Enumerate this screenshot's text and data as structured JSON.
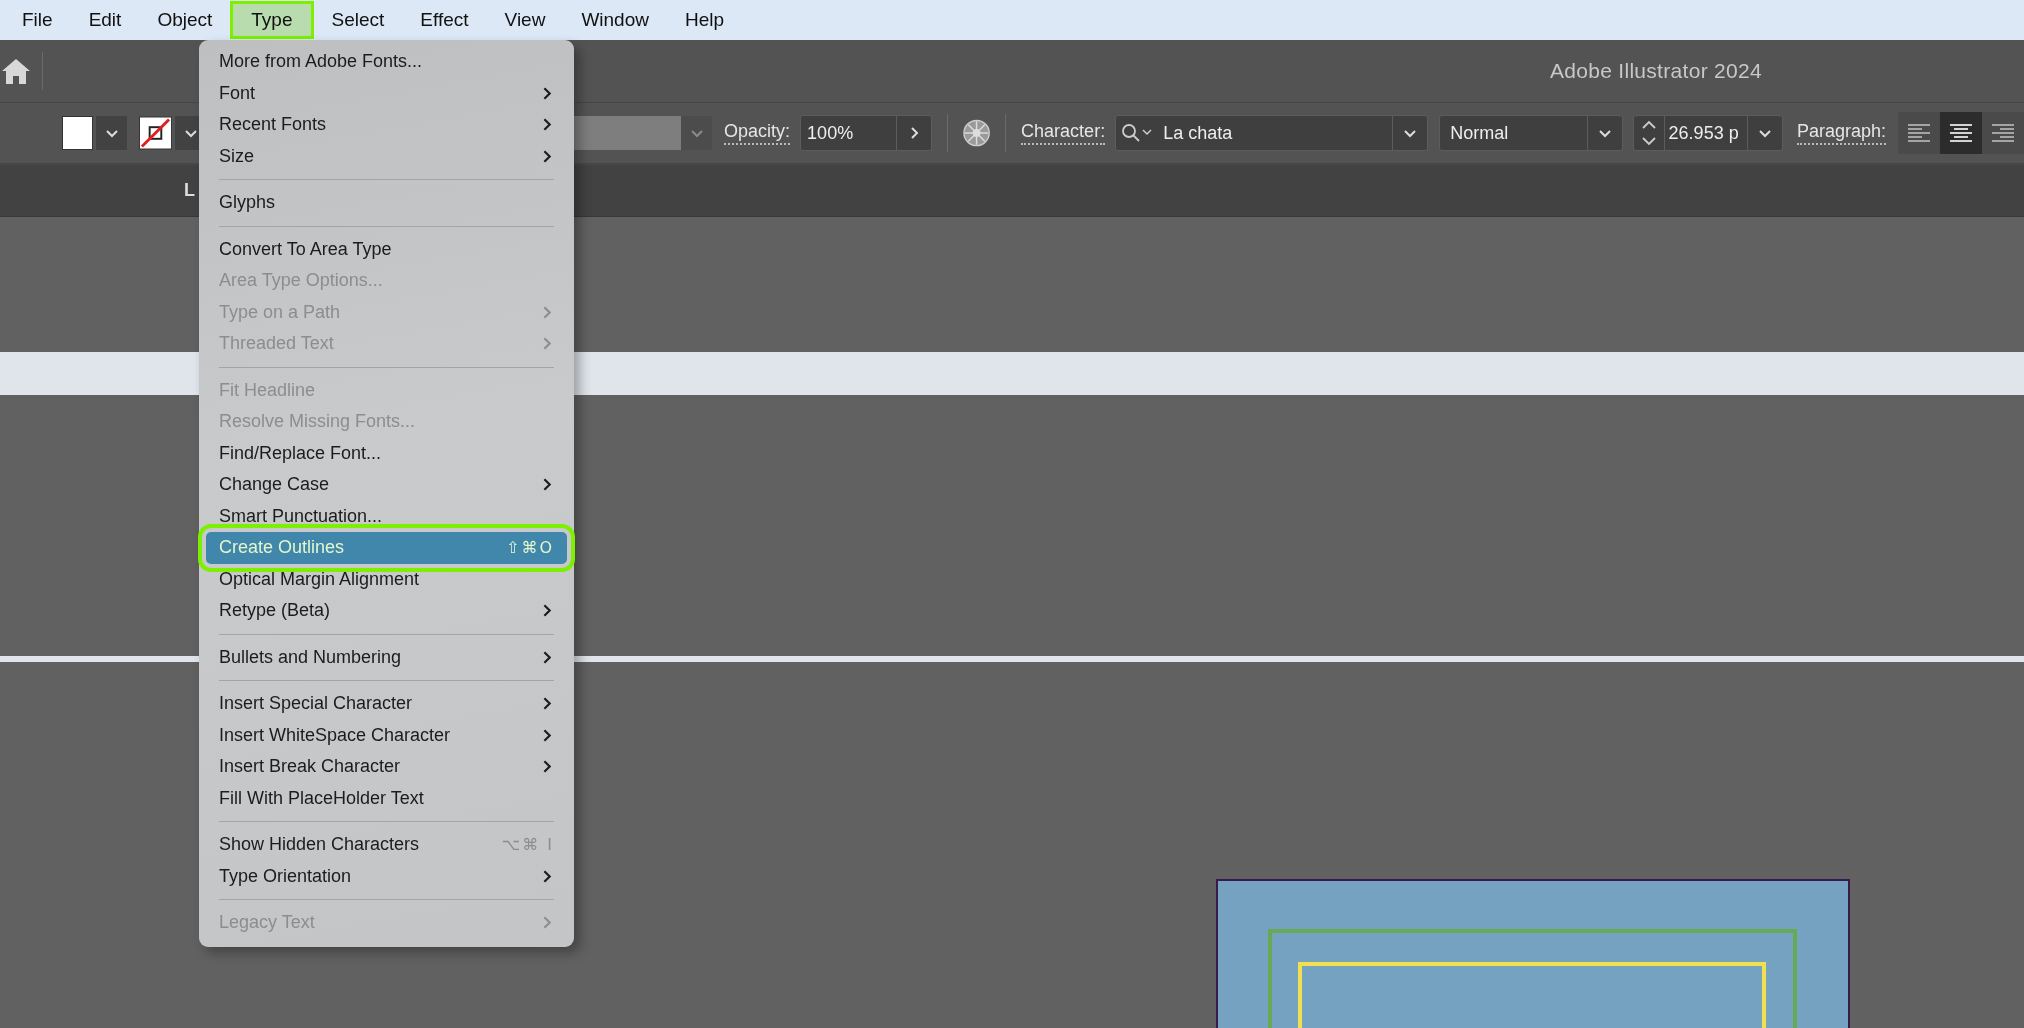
{
  "menubar": {
    "items": [
      {
        "label": "File",
        "selected": false
      },
      {
        "label": "Edit",
        "selected": false
      },
      {
        "label": "Object",
        "selected": false
      },
      {
        "label": "Type",
        "selected": true
      },
      {
        "label": "Select",
        "selected": false
      },
      {
        "label": "Effect",
        "selected": false
      },
      {
        "label": "View",
        "selected": false
      },
      {
        "label": "Window",
        "selected": false
      },
      {
        "label": "Help",
        "selected": false
      }
    ]
  },
  "app_bar": {
    "title": "Adobe Illustrator 2024"
  },
  "control_bar": {
    "opacity_label": "Opacity:",
    "opacity_value": "100%",
    "character_label": "Character:",
    "font_family": "La chata",
    "font_style": "Normal",
    "font_size": "26.953 p",
    "paragraph_label": "Paragraph:",
    "align_buttons": [
      {
        "kind": "left",
        "selected": false
      },
      {
        "kind": "center",
        "selected": true
      },
      {
        "kind": "right",
        "selected": false
      }
    ]
  },
  "tabs": [
    {
      "label": "L"
    }
  ],
  "type_menu": {
    "groups": [
      {
        "items": [
          {
            "label": "More from Adobe Fonts...",
            "disabled": false,
            "submenu": false,
            "selected": false
          },
          {
            "label": "Font",
            "disabled": false,
            "submenu": true,
            "selected": false
          },
          {
            "label": "Recent Fonts",
            "disabled": false,
            "submenu": true,
            "selected": false
          },
          {
            "label": "Size",
            "disabled": false,
            "submenu": true,
            "selected": false
          }
        ]
      },
      {
        "items": [
          {
            "label": "Glyphs",
            "disabled": false,
            "submenu": false,
            "selected": false
          }
        ]
      },
      {
        "items": [
          {
            "label": "Convert To Area Type",
            "disabled": false,
            "submenu": false,
            "selected": false
          },
          {
            "label": "Area Type Options...",
            "disabled": true,
            "submenu": false,
            "selected": false
          },
          {
            "label": "Type on a Path",
            "disabled": true,
            "submenu": true,
            "selected": false
          },
          {
            "label": "Threaded Text",
            "disabled": true,
            "submenu": true,
            "selected": false
          }
        ]
      },
      {
        "items": [
          {
            "label": "Fit Headline",
            "disabled": true,
            "submenu": false,
            "selected": false
          },
          {
            "label": "Resolve Missing Fonts...",
            "disabled": true,
            "submenu": false,
            "selected": false
          },
          {
            "label": "Find/Replace Font...",
            "disabled": false,
            "submenu": false,
            "selected": false
          },
          {
            "label": "Change Case",
            "disabled": false,
            "submenu": true,
            "selected": false
          },
          {
            "label": "Smart Punctuation...",
            "disabled": false,
            "submenu": false,
            "selected": false
          },
          {
            "label": "Create Outlines",
            "disabled": false,
            "submenu": false,
            "shortcut": "⇧⌘O",
            "selected": true
          },
          {
            "label": "Optical Margin Alignment",
            "disabled": false,
            "submenu": false,
            "selected": false
          },
          {
            "label": "Retype (Beta)",
            "disabled": false,
            "submenu": true,
            "selected": false
          }
        ]
      },
      {
        "items": [
          {
            "label": "Bullets and Numbering",
            "disabled": false,
            "submenu": true,
            "selected": false
          }
        ]
      },
      {
        "items": [
          {
            "label": "Insert Special Character",
            "disabled": false,
            "submenu": true,
            "selected": false
          },
          {
            "label": "Insert WhiteSpace Character",
            "disabled": false,
            "submenu": true,
            "selected": false
          },
          {
            "label": "Insert Break Character",
            "disabled": false,
            "submenu": true,
            "selected": false
          },
          {
            "label": "Fill With PlaceHolder Text",
            "disabled": false,
            "submenu": false,
            "selected": false
          }
        ]
      },
      {
        "items": [
          {
            "label": "Show Hidden Characters",
            "disabled": false,
            "submenu": false,
            "shortcut": "⌥⌘ I",
            "selected": false
          },
          {
            "label": "Type Orientation",
            "disabled": false,
            "submenu": true,
            "selected": false
          }
        ]
      },
      {
        "items": [
          {
            "label": "Legacy Text",
            "disabled": true,
            "submenu": true,
            "selected": false
          }
        ]
      }
    ]
  }
}
